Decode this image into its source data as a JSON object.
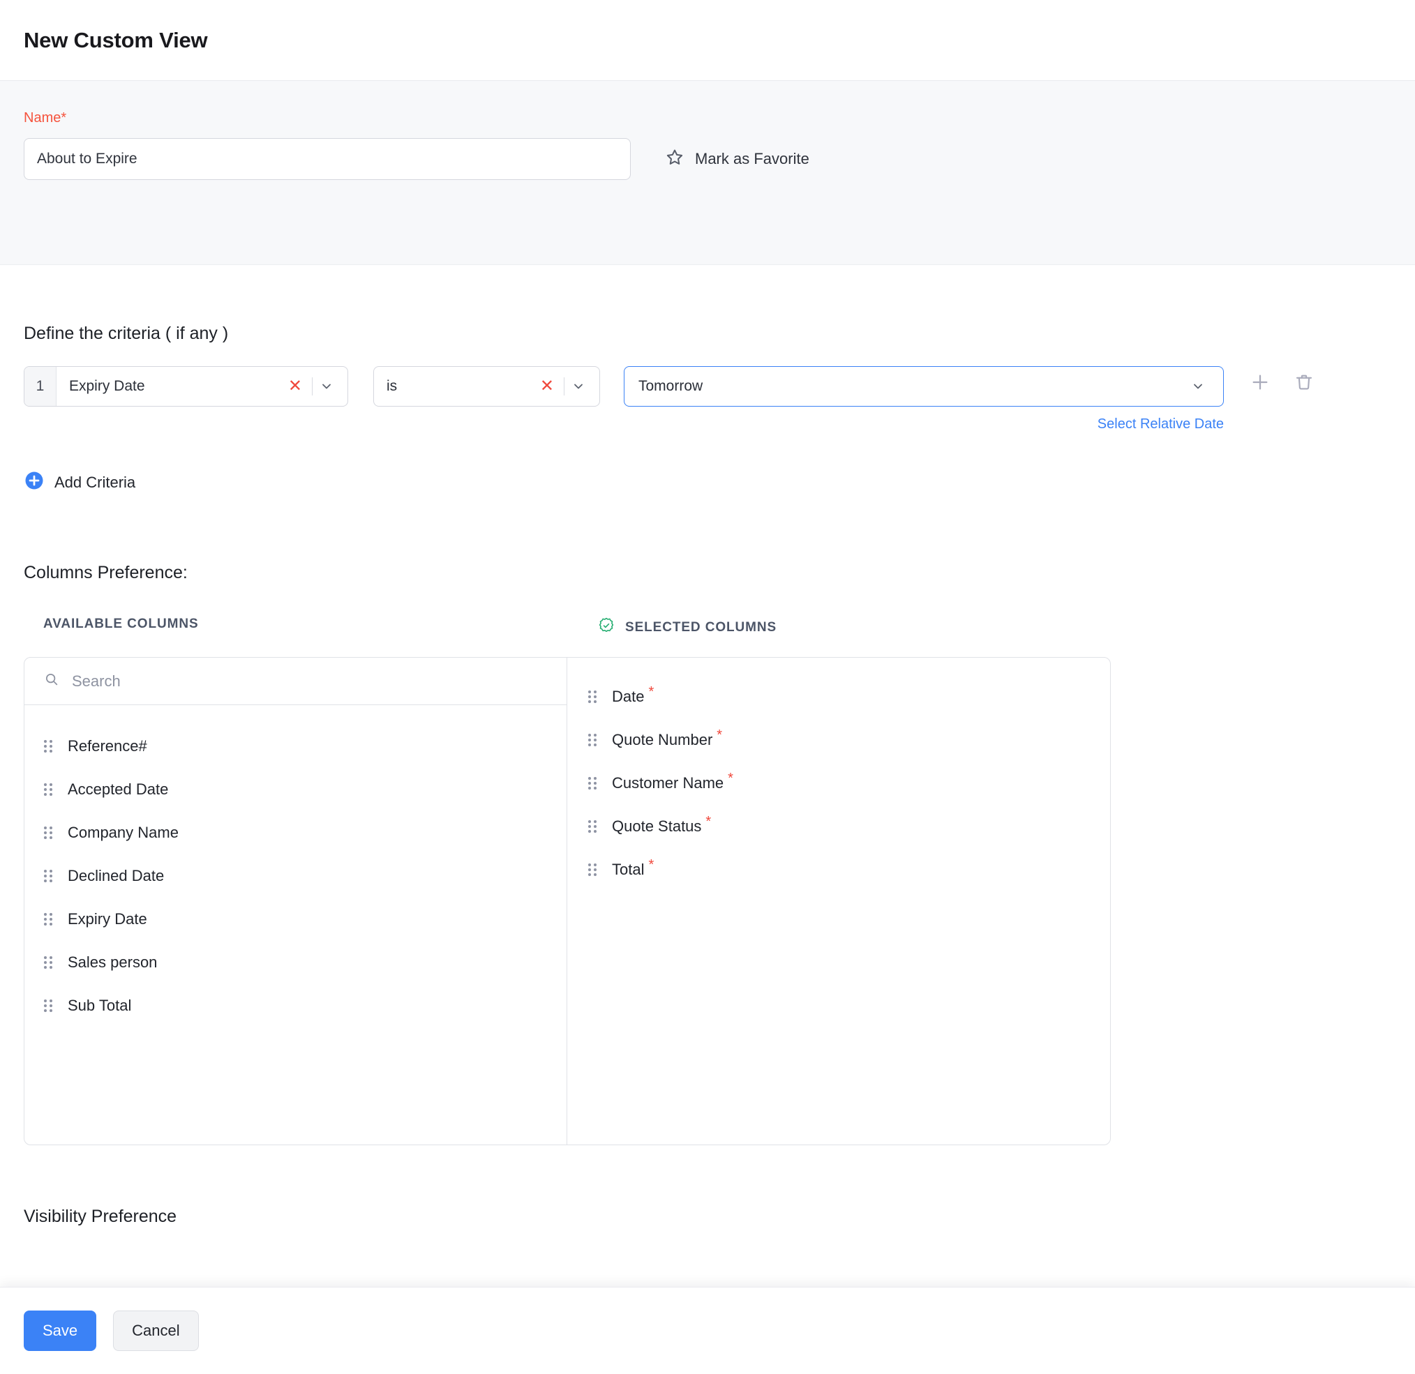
{
  "header": {
    "title": "New Custom View"
  },
  "name_section": {
    "label": "Name*",
    "value": "About to Expire",
    "placeholder": "",
    "favorite_label": "Mark as Favorite",
    "favorite_icon": "star-outline-icon"
  },
  "criteria_section": {
    "title": "Define the criteria ( if any )",
    "rows": [
      {
        "index": "1",
        "field": "Expiry Date",
        "operator": "is",
        "value": "Tomorrow",
        "relative_date_link": "Select Relative Date",
        "clear_icon": "clear-x-icon",
        "chevron_icon": "chevron-down-icon"
      }
    ],
    "add_icon": "plus-circle-icon",
    "add_label": "Add Criteria",
    "row_add_icon": "plus-icon",
    "row_delete_icon": "trash-icon"
  },
  "columns_section": {
    "title": "Columns Preference:",
    "available_heading": "AVAILABLE COLUMNS",
    "selected_heading": "SELECTED COLUMNS",
    "selected_heading_icon": "verified-check-badge-icon",
    "search": {
      "placeholder": "Search",
      "value": "",
      "icon": "search-icon"
    },
    "available": [
      {
        "label": "Reference#"
      },
      {
        "label": "Accepted Date"
      },
      {
        "label": "Company Name"
      },
      {
        "label": "Declined Date"
      },
      {
        "label": "Expiry Date"
      },
      {
        "label": "Sales person"
      },
      {
        "label": "Sub Total"
      }
    ],
    "selected": [
      {
        "label": "Date",
        "required": "*"
      },
      {
        "label": "Quote Number",
        "required": "*"
      },
      {
        "label": "Customer Name",
        "required": "*"
      },
      {
        "label": "Quote Status",
        "required": "*"
      },
      {
        "label": "Total",
        "required": "*"
      }
    ],
    "drag_handle_icon": "drag-handle-icon"
  },
  "visibility_section": {
    "title": "Visibility Preference"
  },
  "footer": {
    "save_label": "Save",
    "cancel_label": "Cancel"
  },
  "colors": {
    "accent_blue": "#3b82f6",
    "required_red": "#f0483c",
    "label_red": "#f5533d",
    "badge_green": "#27ae72",
    "band_gray": "#f7f8fa"
  }
}
